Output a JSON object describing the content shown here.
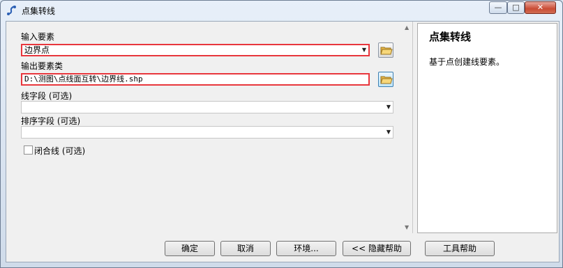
{
  "window": {
    "title": "点集转线"
  },
  "controls": {
    "minimize": "—",
    "maximize": "□",
    "close": "✕"
  },
  "form": {
    "input_features": {
      "label": "输入要素",
      "value": "边界点"
    },
    "output_features": {
      "label": "输出要素类",
      "value": "D:\\测图\\点线面互转\\边界线.shp"
    },
    "line_field": {
      "label": "线字段 (可选)",
      "value": ""
    },
    "sort_field": {
      "label": "排序字段 (可选)",
      "value": ""
    },
    "close_line": {
      "label": "闭合线 (可选)",
      "checked": false
    }
  },
  "help": {
    "title": "点集转线",
    "text": "基于点创建线要素。"
  },
  "buttons": {
    "ok": "确定",
    "cancel": "取消",
    "env": "环境...",
    "hide_help": "<< 隐藏帮助",
    "tool_help": "工具帮助"
  },
  "colors": {
    "required_border": "#e8363c"
  }
}
